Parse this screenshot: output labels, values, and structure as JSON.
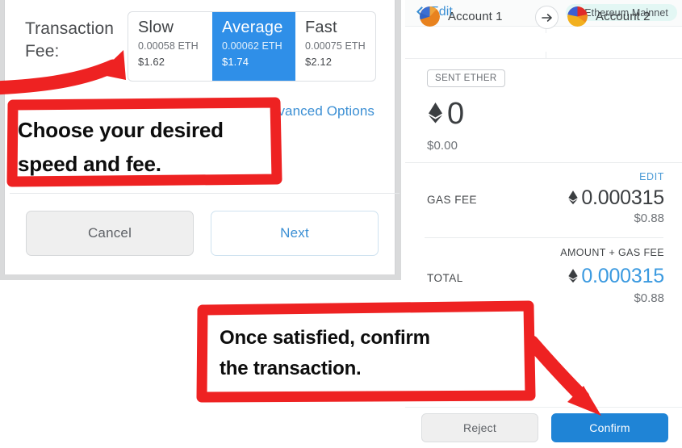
{
  "left_panel": {
    "transaction_fee_label": "Transaction Fee:",
    "fee_options": [
      {
        "name": "Slow",
        "eth": "0.00058 ETH",
        "usd": "$1.62",
        "selected": false
      },
      {
        "name": "Average",
        "eth": "0.00062 ETH",
        "usd": "$1.74",
        "selected": true
      },
      {
        "name": "Fast",
        "eth": "0.00075 ETH",
        "usd": "$2.12",
        "selected": false
      }
    ],
    "advanced_options_label": "Advanced Options",
    "cancel_label": "Cancel",
    "next_label": "Next"
  },
  "right_panel": {
    "back_label": "Edit",
    "back_icon": "chevron-left-icon",
    "network_name": "Ethereum Mainnet",
    "network_dot_color": "#29bdaa",
    "network_badge_bg": "#e3f7f4",
    "from_account": "Account 1",
    "to_account": "Account 2",
    "transfer_arrow_icon": "arrow-right-icon",
    "sent_chip_label": "SENT ETHER",
    "sent_amount": "0",
    "sent_eth_icon": "ethereum-diamond-icon",
    "sent_fiat": "$0.00",
    "edit_link_label": "EDIT",
    "gas_fee_label": "GAS FEE",
    "gas_fee_value": "0.000315",
    "gas_fee_fiat": "$0.88",
    "amount_plus_gas_label": "AMOUNT + GAS FEE",
    "total_label": "TOTAL",
    "total_value": "0.000315",
    "total_fiat": "$0.88",
    "reject_label": "Reject",
    "confirm_label": "Confirm",
    "confirm_color": "#1f84d6"
  },
  "annotations": {
    "accent_color": "#ee2222",
    "note_1_line_1": "Choose your desired",
    "note_1_line_2": "speed and fee.",
    "note_2_line_1": "Once satisfied, confirm",
    "note_2_line_2": "the transaction."
  }
}
